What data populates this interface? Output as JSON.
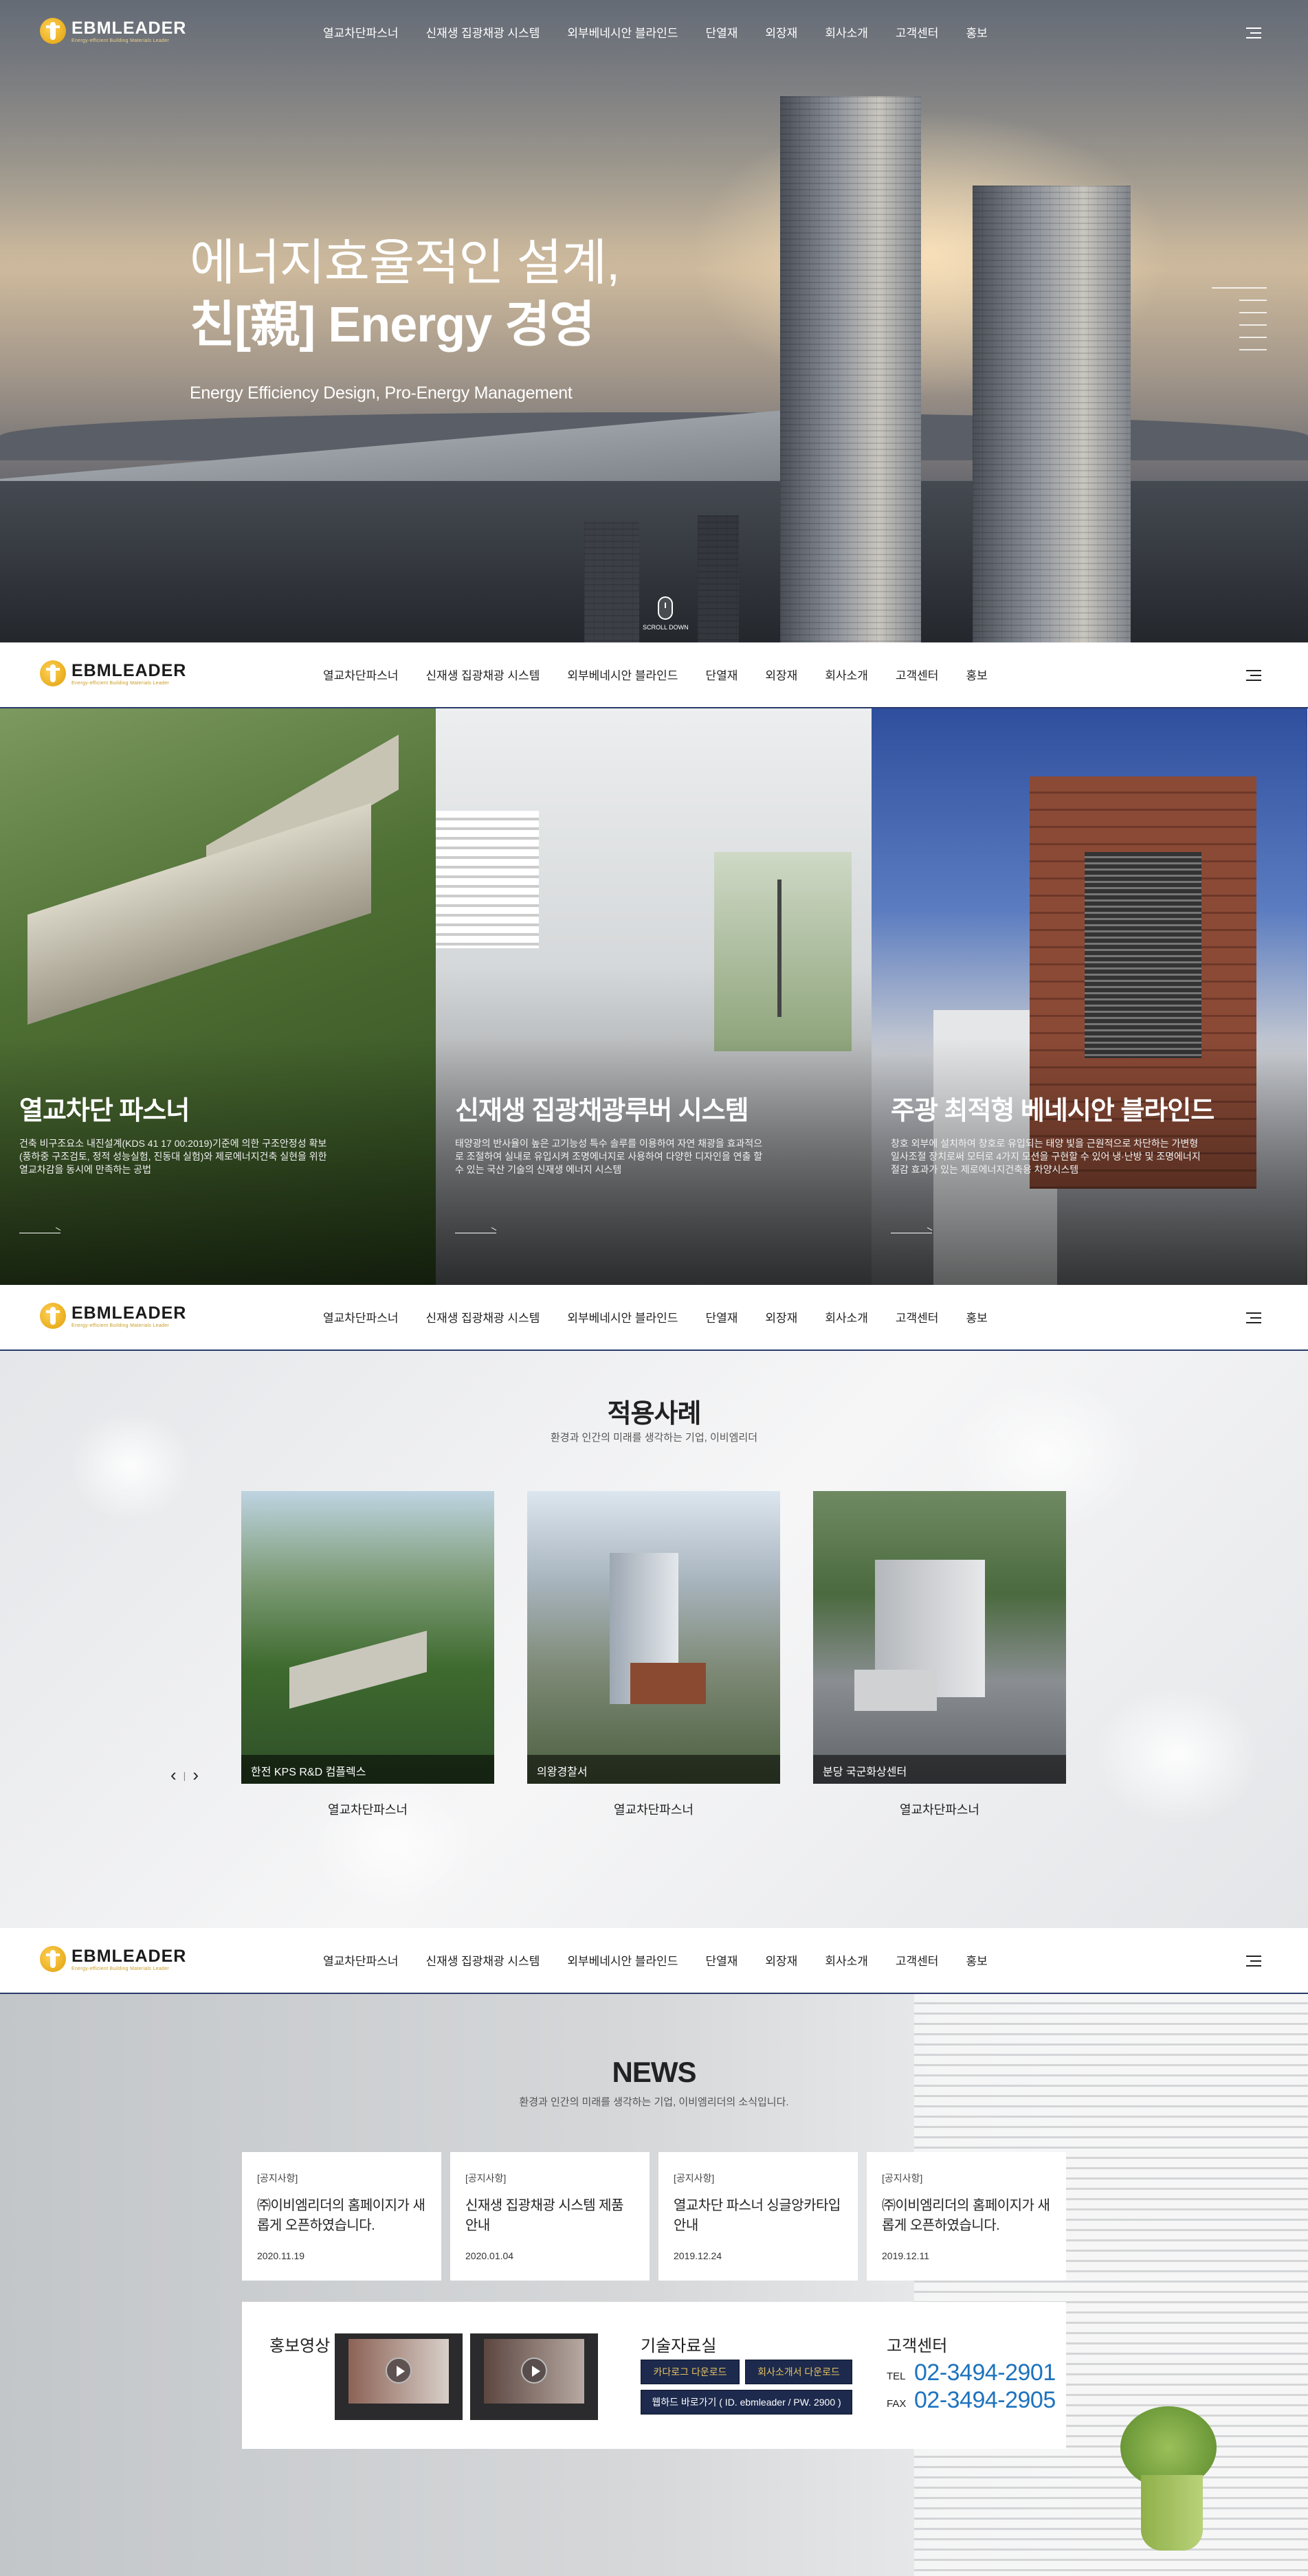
{
  "brand": {
    "name": "EBMLEADER",
    "tagline": "Energy-efficient Building Materials Leader"
  },
  "nav": {
    "items": [
      "열교차단파스너",
      "신재생 집광채광 시스템",
      "외부베네시안 블라인드",
      "단열재",
      "외장재",
      "회사소개",
      "고객센터",
      "홍보"
    ]
  },
  "hero": {
    "title_line1": "에너지효율적인 설계,",
    "title_line2": "친[親] Energy 경영",
    "subtitle": "Energy Efficiency Design, Pro-Energy Management",
    "scroll_label": "SCROLL DOWN"
  },
  "products": [
    {
      "title": "열교차단 파스너",
      "desc": "건축 비구조요소 내진설계(KDS 41 17 00:2019)기준에 의한 구조안정성 확보 (풍하중 구조검토, 정적 성능실험, 진동대 실험)와 제로에너지건축 실현을 위한 열교차감을 동시에 만족하는 공법"
    },
    {
      "title": "신재생 집광채광루버 시스템",
      "desc": "태양광의 반사율이 높은 고기능성 특수 솔루를 이용하여 자연 채광을 효과적으로 조절하여 실내로 유입시켜 조명에너지로 사용하여 다양한 디자인을 연출 할 수 있는 국산 기술의 신재생 에너지 시스템"
    },
    {
      "title": "주광 최적형 베네시안 블라인드",
      "desc": "창호 외부에 설치하여 창호로 유입되는 태양 빛을 근원적으로 차단하는 가변형 일사조절 장치로써 모터로 4가지 모션을 구현할 수 있어 냉·난방 및 조명에너지 절감 효과가 있는 제로에너지건축용 차양시스템"
    }
  ],
  "cases": {
    "title": "적용사례",
    "subtitle": "환경과 인간의 미래를 생각하는 기업, 이비엠리더",
    "items": [
      {
        "label": "한전 KPS R&D 컴플렉스",
        "category": "열교차단파스너"
      },
      {
        "label": "의왕경찰서",
        "category": "열교차단파스너"
      },
      {
        "label": "분당 국군화상센터",
        "category": "열교차단파스너"
      }
    ],
    "prev": "‹",
    "sep": "|",
    "next": "›"
  },
  "news": {
    "title": "NEWS",
    "subtitle": "환경과 인간의 미래를 생각하는 기업, 이비엠리더의 소식입니다.",
    "items": [
      {
        "category": "[공지사항]",
        "title": "㈜이비엠리더의 홈페이지가 새롭게 오픈하였습니다.",
        "date": "2020.11.19"
      },
      {
        "category": "[공지사항]",
        "title": "신재생 집광채광 시스템 제품 안내",
        "date": "2020.01.04"
      },
      {
        "category": "[공지사항]",
        "title": "열교차단 파스너 싱글앙카타입안내",
        "date": "2019.12.24"
      },
      {
        "category": "[공지사항]",
        "title": "㈜이비엠리더의 홈페이지가 새롭게 오픈하였습니다.",
        "date": "2019.12.11"
      }
    ]
  },
  "info": {
    "video_label": "홍보영상",
    "tech_label": "기술자료실",
    "btn_catalog": "카다로그 다운로드",
    "btn_company": "회사소개서 다운로드",
    "btn_webhard": "웹하드 바로가기 ( ID. ebmleader / PW. 2900 )",
    "cs_label": "고객센터",
    "tel_label": "TEL",
    "tel": "02-3494-2901",
    "fax_label": "FAX",
    "fax": "02-3494-2905"
  },
  "colors": {
    "navy": "#1d2a4d",
    "gold": "#e5c260",
    "accent_blue": "#1e73be"
  }
}
